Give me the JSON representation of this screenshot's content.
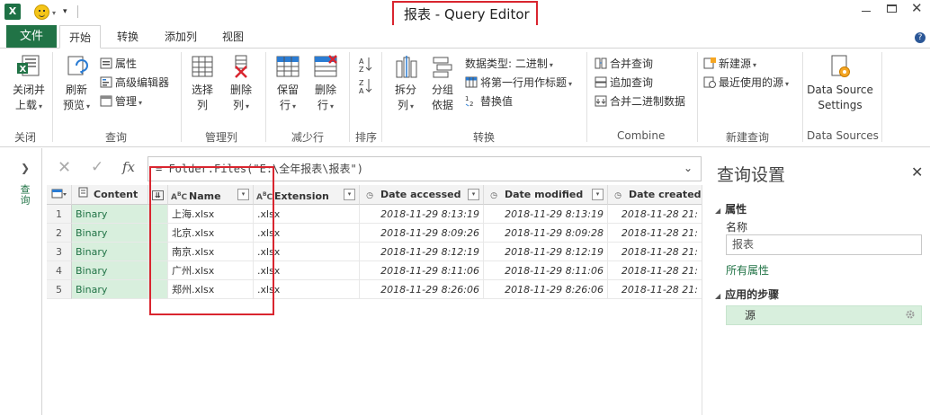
{
  "window": {
    "title": "报表 - Query Editor",
    "app_icon": "X"
  },
  "tabs": {
    "file": "文件",
    "items": [
      "开始",
      "转换",
      "添加列",
      "视图"
    ],
    "active": "开始"
  },
  "ribbon": {
    "close": {
      "button": "关闭并\n上载",
      "label": "关闭并",
      "label2": "上载",
      "group": "关闭"
    },
    "query": {
      "refresh_label": "刷新",
      "refresh_label2": "预览",
      "properties": "属性",
      "advanced_editor": "高级编辑器",
      "manage": "管理",
      "group": "查询"
    },
    "manage_columns": {
      "choose_label": "选择",
      "choose_label2": "列",
      "remove_label": "删除",
      "remove_label2": "列",
      "group": "管理列"
    },
    "reduce_rows": {
      "keep_label": "保留",
      "keep_label2": "行",
      "remove_label": "删除",
      "remove_label2": "行",
      "group": "减少行"
    },
    "sort": {
      "group": "排序"
    },
    "transform": {
      "split_label": "拆分",
      "split_label2": "列",
      "group_label": "分组",
      "group_label2": "依据",
      "data_type": "数据类型: 二进制",
      "first_row_headers": "将第一行用作标题",
      "replace_values": "替换值",
      "group": "转换"
    },
    "combine": {
      "merge": "合并查询",
      "append": "追加查询",
      "combine_binaries": "合并二进制数据",
      "group": "Combine"
    },
    "new_query": {
      "new_source": "新建源",
      "recent_sources": "最近使用的源",
      "group": "新建查询"
    },
    "data_sources": {
      "settings_label": "Data Source",
      "settings_label2": "Settings",
      "group": "Data Sources"
    }
  },
  "left_nav": {
    "label": "查询"
  },
  "formula_bar": {
    "formula": "= Folder.Files(\"E:\\全年报表\\报表\")"
  },
  "table": {
    "columns": [
      {
        "name": "Content",
        "type_icon": "table-icon"
      },
      {
        "name": "Name",
        "type_icon": "ABC"
      },
      {
        "name": "Extension",
        "type_icon": "ABC"
      },
      {
        "name": "Date accessed",
        "type_icon": "clock-icon"
      },
      {
        "name": "Date modified",
        "type_icon": "clock-icon"
      },
      {
        "name": "Date created",
        "type_icon": "clock-icon"
      }
    ],
    "rows": [
      {
        "n": "1",
        "content": "Binary",
        "name": "上海.xlsx",
        "ext": ".xlsx",
        "accessed": "2018-11-29 8:13:19",
        "modified": "2018-11-29 8:13:19",
        "created": "2018-11-28 21:"
      },
      {
        "n": "2",
        "content": "Binary",
        "name": "北京.xlsx",
        "ext": ".xlsx",
        "accessed": "2018-11-29 8:09:26",
        "modified": "2018-11-29 8:09:28",
        "created": "2018-11-28 21:"
      },
      {
        "n": "3",
        "content": "Binary",
        "name": "南京.xlsx",
        "ext": ".xlsx",
        "accessed": "2018-11-29 8:12:19",
        "modified": "2018-11-29 8:12:19",
        "created": "2018-11-28 21:"
      },
      {
        "n": "4",
        "content": "Binary",
        "name": "广州.xlsx",
        "ext": ".xlsx",
        "accessed": "2018-11-29 8:11:06",
        "modified": "2018-11-29 8:11:06",
        "created": "2018-11-28 21:"
      },
      {
        "n": "5",
        "content": "Binary",
        "name": "郑州.xlsx",
        "ext": ".xlsx",
        "accessed": "2018-11-29 8:26:06",
        "modified": "2018-11-29 8:26:06",
        "created": "2018-11-28 21:"
      }
    ]
  },
  "query_settings": {
    "title": "查询设置",
    "properties_header": "属性",
    "name_label": "名称",
    "name_value": "报表",
    "all_properties": "所有属性",
    "applied_steps_header": "应用的步骤",
    "steps": [
      "源"
    ]
  },
  "colors": {
    "accent": "#217346",
    "highlight_red": "#d9252f",
    "selected_green": "#d8efdd"
  }
}
